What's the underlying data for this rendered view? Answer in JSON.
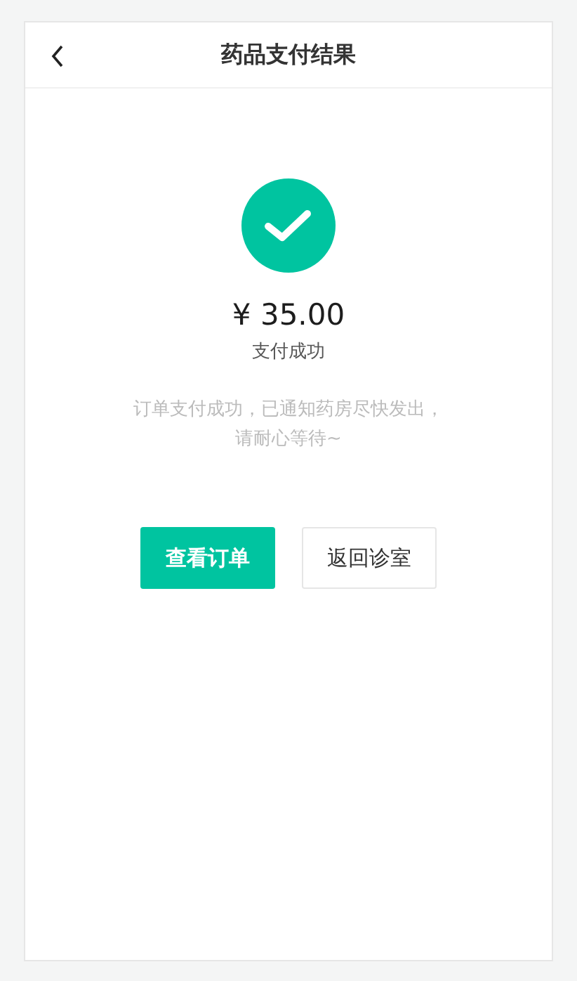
{
  "header": {
    "title": "药品支付结果"
  },
  "result": {
    "amount": "¥ 35.00",
    "status": "支付成功",
    "message_lines": [
      "订单支付成功，已通知药房尽快发出，",
      "请耐心等待~"
    ]
  },
  "buttons": [
    {
      "label": "查看订单",
      "kind": "primary"
    },
    {
      "label": "返回诊室",
      "kind": "secondary"
    }
  ]
}
